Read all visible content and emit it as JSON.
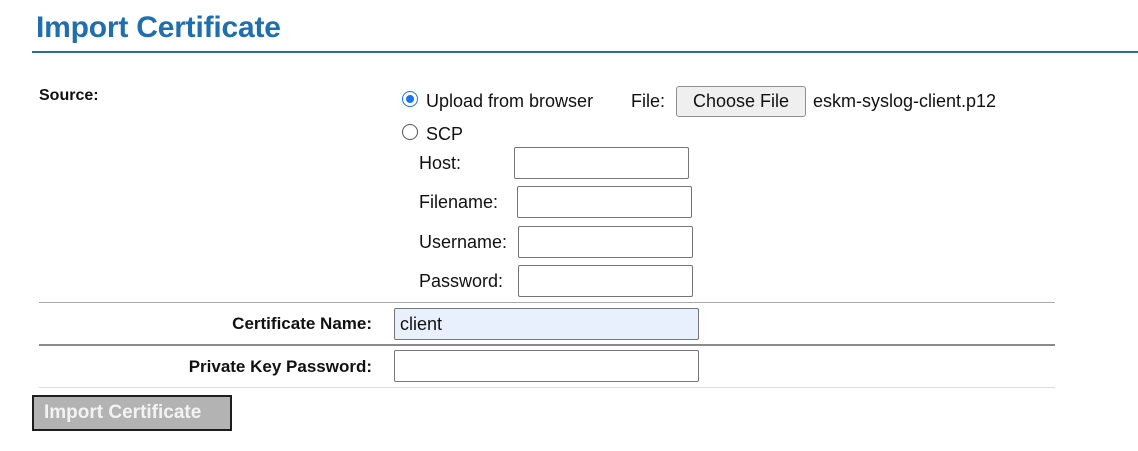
{
  "page": {
    "title": "Import Certificate"
  },
  "source": {
    "label": "Source:",
    "options": [
      {
        "label": "Upload from browser",
        "selected": true
      },
      {
        "label": "SCP",
        "selected": false
      }
    ],
    "file_label": "File:",
    "choose_file_label": "Choose File",
    "chosen_file": "eskm-syslog-client.p12",
    "scp": {
      "host_label": "Host:",
      "host_value": "",
      "filename_label": "Filename:",
      "filename_value": "",
      "username_label": "Username:",
      "username_value": "",
      "password_label": "Password:",
      "password_value": ""
    }
  },
  "certificate_name": {
    "label": "Certificate Name:",
    "value": "client"
  },
  "private_key_password": {
    "label": "Private Key Password:",
    "value": ""
  },
  "submit": {
    "label": "Import Certificate",
    "enabled": false
  },
  "colors": {
    "title": "#1f6fae",
    "title_rule": "#2d6f95",
    "radio_selected": "#1a73e8",
    "autofill_bg": "#e8f0fe",
    "disabled_button_bg": "#b3b3b3"
  }
}
